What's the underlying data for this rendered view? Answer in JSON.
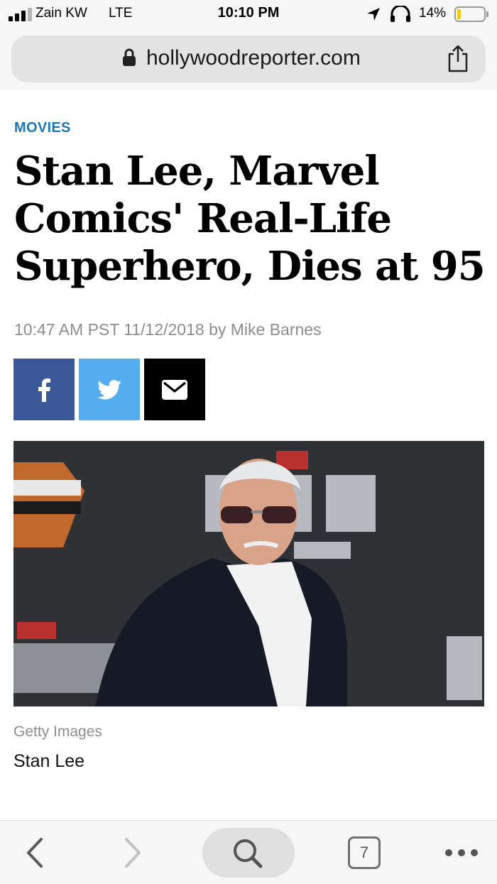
{
  "status_bar": {
    "carrier": "Zain KW",
    "network": "LTE",
    "time": "10:10 PM",
    "battery_percent": "14%",
    "battery_level": 0.14,
    "icons": [
      "signal-bars-icon",
      "location-arrow-icon",
      "headphones-icon",
      "battery-icon"
    ]
  },
  "address_bar": {
    "url": "hollywoodreporter.com",
    "icons": [
      "lock-icon",
      "share-icon"
    ]
  },
  "article": {
    "section": "MOVIES",
    "headline_lines": [
      "Stan Lee, Marvel",
      "Comics' Real-Life",
      "Superhero, Dies at 95"
    ],
    "byline": "10:47 AM PST 11/12/2018 by Mike Barnes",
    "share_buttons": [
      {
        "icon": "facebook-icon",
        "color": "#3b5998"
      },
      {
        "icon": "twitter-icon",
        "color": "#55acee"
      },
      {
        "icon": "email-icon",
        "color": "#000000"
      }
    ],
    "photo_credit": "Getty Images",
    "photo_caption": "Stan Lee"
  },
  "toolbar": {
    "tabs_count": "7",
    "icons": [
      "back-chevron-icon",
      "forward-chevron-icon",
      "search-icon",
      "tabs-icon",
      "more-icon"
    ]
  },
  "colors": {
    "section_accent": "#1d77b3",
    "byline_gray": "#8d8d8d",
    "chrome_background": "#f6f6f6"
  }
}
